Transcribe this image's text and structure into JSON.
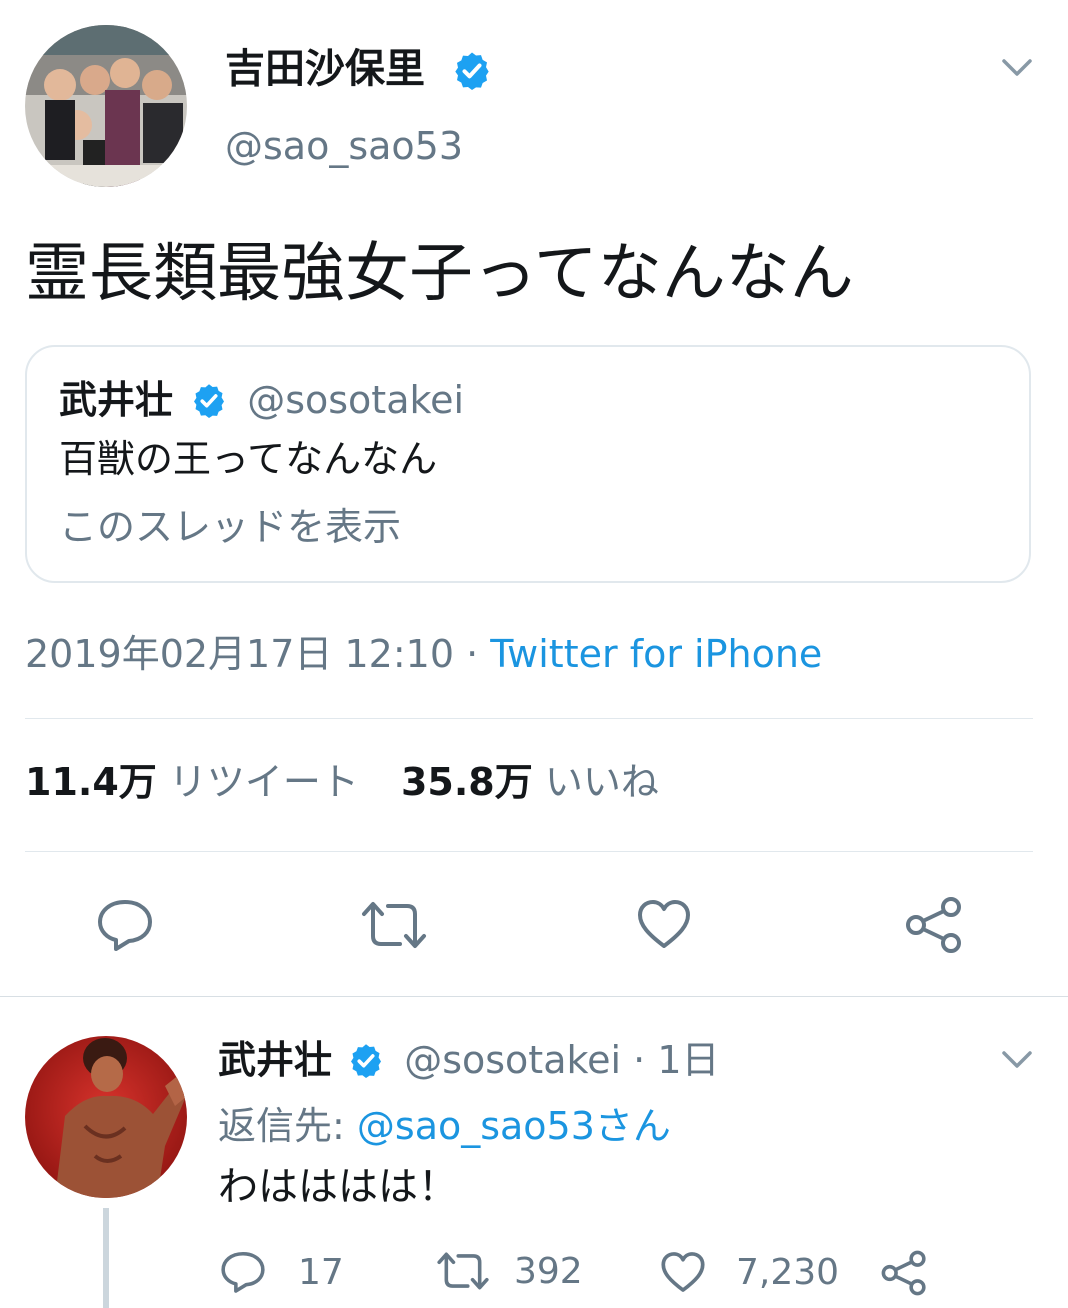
{
  "tweet": {
    "author_name": "吉田沙保里",
    "author_handle": "@sao_sao53",
    "text": "霊長類最強女子ってなんなん",
    "quote": {
      "author_name": "武井壮",
      "author_handle": "@sosotakei",
      "text": "百獣の王ってなんなん",
      "thread_link": "このスレッドを表示"
    },
    "timestamp": "2019年02月17日 12:10 · ",
    "source": "Twitter for iPhone",
    "retweet_count": "11.4万",
    "retweet_label": "リツイート",
    "like_count": "35.8万",
    "like_label": "いいね"
  },
  "reply": {
    "author_name": "武井壮",
    "author_handle": "@sosotakei",
    "age": " · 1日",
    "reply_to_prefix": "返信先: ",
    "reply_to_handle": "@sao_sao53さん",
    "text": "わはははは！",
    "reply_count": "17",
    "retweet_count": "392",
    "like_count": "7,230"
  },
  "colors": {
    "accent": "#1b95e0",
    "muted": "#657786",
    "verified": "#1da1f2"
  }
}
